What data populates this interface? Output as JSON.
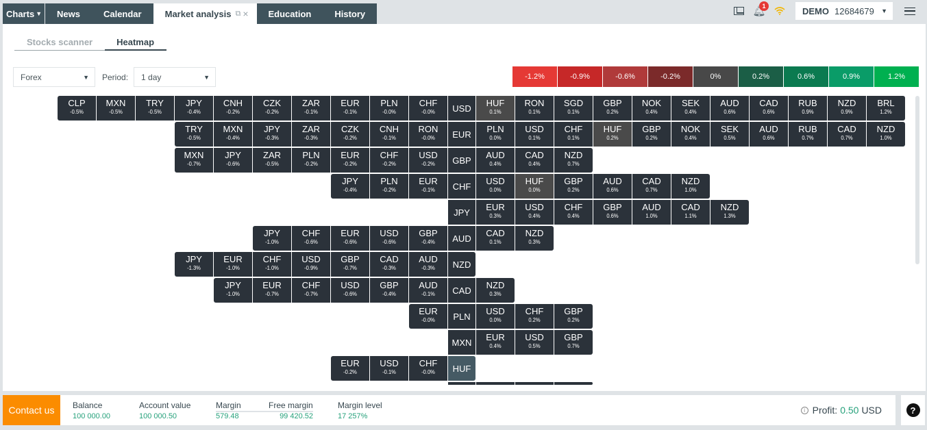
{
  "tabs": [
    {
      "label": "Charts",
      "active": false
    },
    {
      "label": "News",
      "active": false
    },
    {
      "label": "Calendar",
      "active": false
    },
    {
      "label": "Market analysis",
      "active": true
    },
    {
      "label": "Education",
      "active": false
    },
    {
      "label": "History",
      "active": false
    }
  ],
  "topbar": {
    "notification_count": "1",
    "account_type": "DEMO",
    "account_number": "12684679"
  },
  "subtabs": [
    {
      "label": "Stocks scanner",
      "active": false
    },
    {
      "label": "Heatmap",
      "active": true
    }
  ],
  "filters": {
    "market": "Forex",
    "period_label": "Period:",
    "period": "1 day"
  },
  "legend": [
    {
      "label": "-1.2%",
      "color": "#e53935"
    },
    {
      "label": "-0.9%",
      "color": "#c62828"
    },
    {
      "label": "-0.6%",
      "color": "#b03a3a"
    },
    {
      "label": "-0.2%",
      "color": "#7b2a2a"
    },
    {
      "label": "0%",
      "color": "#484848"
    },
    {
      "label": "0.2%",
      "color": "#1b5e46"
    },
    {
      "label": "0.6%",
      "color": "#0b7a50"
    },
    {
      "label": "0.9%",
      "color": "#0a9c68"
    },
    {
      "label": "1.2%",
      "color": "#00b050"
    }
  ],
  "heatmap": [
    {
      "base": "USD",
      "left": [
        [
          "CLP",
          "-0.5%"
        ],
        [
          "MXN",
          "-0.5%"
        ],
        [
          "TRY",
          "-0.5%"
        ],
        [
          "JPY",
          "-0.4%"
        ],
        [
          "CNH",
          "-0.2%"
        ],
        [
          "CZK",
          "-0.2%"
        ],
        [
          "ZAR",
          "-0.1%"
        ],
        [
          "EUR",
          "-0.1%"
        ],
        [
          "PLN",
          "-0.0%"
        ],
        [
          "CHF",
          "-0.0%"
        ]
      ],
      "right": [
        [
          "HUF",
          "0.1%"
        ],
        [
          "RON",
          "0.1%"
        ],
        [
          "SGD",
          "0.1%"
        ],
        [
          "GBP",
          "0.2%"
        ],
        [
          "NOK",
          "0.4%"
        ],
        [
          "SEK",
          "0.4%"
        ],
        [
          "AUD",
          "0.6%"
        ],
        [
          "CAD",
          "0.6%"
        ],
        [
          "RUB",
          "0.9%"
        ],
        [
          "NZD",
          "0.9%"
        ],
        [
          "BRL",
          "1.2%"
        ]
      ],
      "highlight": "HUF"
    },
    {
      "base": "EUR",
      "left": [
        [
          "TRY",
          "-0.5%"
        ],
        [
          "MXN",
          "-0.4%"
        ],
        [
          "JPY",
          "-0.3%"
        ],
        [
          "ZAR",
          "-0.3%"
        ],
        [
          "CZK",
          "-0.2%"
        ],
        [
          "CNH",
          "-0.1%"
        ],
        [
          "RON",
          "-0.0%"
        ]
      ],
      "right": [
        [
          "PLN",
          "0.0%"
        ],
        [
          "USD",
          "0.1%"
        ],
        [
          "CHF",
          "0.1%"
        ],
        [
          "HUF",
          "0.2%"
        ],
        [
          "GBP",
          "0.2%"
        ],
        [
          "NOK",
          "0.4%"
        ],
        [
          "SEK",
          "0.5%"
        ],
        [
          "AUD",
          "0.6%"
        ],
        [
          "RUB",
          "0.7%"
        ],
        [
          "CAD",
          "0.7%"
        ],
        [
          "NZD",
          "1.0%"
        ]
      ],
      "highlight": "HUF"
    },
    {
      "base": "GBP",
      "left": [
        [
          "MXN",
          "-0.7%"
        ],
        [
          "JPY",
          "-0.6%"
        ],
        [
          "ZAR",
          "-0.5%"
        ],
        [
          "PLN",
          "-0.2%"
        ],
        [
          "EUR",
          "-0.2%"
        ],
        [
          "CHF",
          "-0.2%"
        ],
        [
          "USD",
          "-0.2%"
        ]
      ],
      "right": [
        [
          "AUD",
          "0.4%"
        ],
        [
          "CAD",
          "0.4%"
        ],
        [
          "NZD",
          "0.7%"
        ]
      ]
    },
    {
      "base": "CHF",
      "left": [
        [
          "JPY",
          "-0.4%"
        ],
        [
          "PLN",
          "-0.2%"
        ],
        [
          "EUR",
          "-0.1%"
        ]
      ],
      "right": [
        [
          "USD",
          "0.0%"
        ],
        [
          "HUF",
          "0.0%"
        ],
        [
          "GBP",
          "0.2%"
        ],
        [
          "AUD",
          "0.6%"
        ],
        [
          "CAD",
          "0.7%"
        ],
        [
          "NZD",
          "1.0%"
        ]
      ],
      "highlight": "HUF"
    },
    {
      "base": "JPY",
      "left": [],
      "right": [
        [
          "EUR",
          "0.3%"
        ],
        [
          "USD",
          "0.4%"
        ],
        [
          "CHF",
          "0.4%"
        ],
        [
          "GBP",
          "0.6%"
        ],
        [
          "AUD",
          "1.0%"
        ],
        [
          "CAD",
          "1.1%"
        ],
        [
          "NZD",
          "1.3%"
        ]
      ]
    },
    {
      "base": "AUD",
      "left": [
        [
          "JPY",
          "-1.0%"
        ],
        [
          "CHF",
          "-0.6%"
        ],
        [
          "EUR",
          "-0.6%"
        ],
        [
          "USD",
          "-0.6%"
        ],
        [
          "GBP",
          "-0.4%"
        ]
      ],
      "right": [
        [
          "CAD",
          "0.1%"
        ],
        [
          "NZD",
          "0.3%"
        ]
      ]
    },
    {
      "base": "NZD",
      "left": [
        [
          "JPY",
          "-1.3%"
        ],
        [
          "EUR",
          "-1.0%"
        ],
        [
          "CHF",
          "-1.0%"
        ],
        [
          "USD",
          "-0.9%"
        ],
        [
          "GBP",
          "-0.7%"
        ],
        [
          "CAD",
          "-0.3%"
        ],
        [
          "AUD",
          "-0.3%"
        ]
      ],
      "right": []
    },
    {
      "base": "CAD",
      "left": [
        [
          "JPY",
          "-1.0%"
        ],
        [
          "EUR",
          "-0.7%"
        ],
        [
          "CHF",
          "-0.7%"
        ],
        [
          "USD",
          "-0.6%"
        ],
        [
          "GBP",
          "-0.4%"
        ],
        [
          "AUD",
          "-0.1%"
        ]
      ],
      "right": [
        [
          "NZD",
          "0.3%"
        ]
      ]
    },
    {
      "base": "PLN",
      "left": [
        [
          "EUR",
          "-0.0%"
        ]
      ],
      "right": [
        [
          "USD",
          "0.0%"
        ],
        [
          "CHF",
          "0.2%"
        ],
        [
          "GBP",
          "0.2%"
        ]
      ]
    },
    {
      "base": "MXN",
      "left": [],
      "right": [
        [
          "EUR",
          "0.4%"
        ],
        [
          "USD",
          "0.5%"
        ],
        [
          "GBP",
          "0.7%"
        ]
      ]
    },
    {
      "base": "HUF",
      "left": [
        [
          "EUR",
          "-0.2%"
        ],
        [
          "USD",
          "-0.1%"
        ],
        [
          "CHF",
          "-0.0%"
        ]
      ],
      "right": [],
      "base_highlight": true
    },
    {
      "base": "",
      "left": [],
      "right": [
        [
          "",
          ""
        ],
        [
          "",
          ""
        ],
        [
          "",
          ""
        ]
      ],
      "partial": true
    }
  ],
  "bottombar": {
    "contact_label": "Contact us",
    "stats": [
      {
        "label": "Balance",
        "value": "100 000.00"
      },
      {
        "label": "Account value",
        "value": "100 000.50"
      },
      {
        "label": "Margin",
        "value": "579.48"
      },
      {
        "label": "Free margin",
        "value": "99 420.52"
      },
      {
        "label": "Margin level",
        "value": "17 257%"
      }
    ],
    "profit_label": "Profit:",
    "profit_value": "0.50",
    "profit_currency": "USD",
    "help_label": "?"
  }
}
